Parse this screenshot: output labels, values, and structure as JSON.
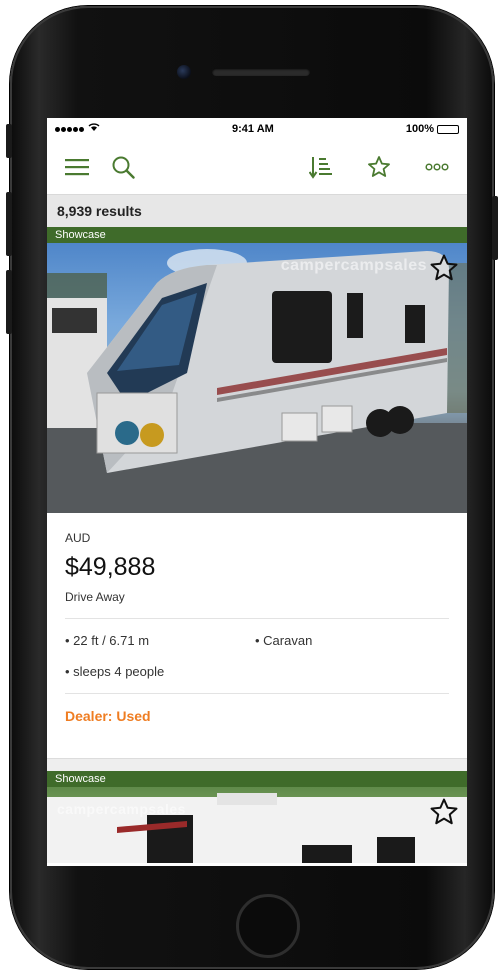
{
  "status_bar": {
    "time": "9:41 AM",
    "battery": "100%",
    "battery_level": 1.0
  },
  "toolbar": {
    "menu_icon": "hamburger-icon",
    "search_icon": "search-icon",
    "sort_icon": "sort-icon",
    "favorites_icon": "star-icon",
    "more_icon": "more-icon",
    "accent": "#4a7a30"
  },
  "results": {
    "count_text": "8,939 results"
  },
  "listings": [
    {
      "badge": "Showcase",
      "watermark": "campercampsales",
      "currency": "AUD",
      "price": "$49,888",
      "price_note": "Drive Away",
      "spec_length": "• 22 ft / 6.71 m",
      "spec_type": "• Caravan",
      "spec_sleeps": "• sleeps 4 people",
      "dealer_status": "Dealer: Used"
    },
    {
      "badge": "Showcase",
      "watermark": "campercampsales"
    }
  ],
  "colors": {
    "showcase_band": "#3f6b2a",
    "dealer_text": "#ef7d22"
  }
}
